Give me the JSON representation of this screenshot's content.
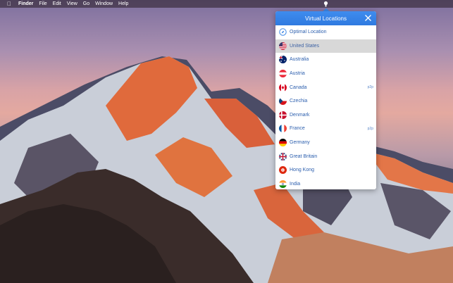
{
  "menubar": {
    "apple_icon": "apple-icon",
    "items": [
      "Finder",
      "File",
      "Edit",
      "View",
      "Go",
      "Window",
      "Help"
    ]
  },
  "panel": {
    "title": "Virtual Locations",
    "accent": "#3a86e6",
    "locations": [
      {
        "label": "Optimal Location",
        "icon": "compass-icon",
        "badge": ""
      },
      {
        "label": "United States",
        "icon": "flag-us-icon",
        "badge": "",
        "selected": true
      },
      {
        "label": "Australia",
        "icon": "flag-au-icon",
        "badge": ""
      },
      {
        "label": "Austria",
        "icon": "flag-at-icon",
        "badge": ""
      },
      {
        "label": "Canada",
        "icon": "flag-ca-icon",
        "badge": "p2p"
      },
      {
        "label": "Czechia",
        "icon": "flag-cz-icon",
        "badge": ""
      },
      {
        "label": "Denmark",
        "icon": "flag-dk-icon",
        "badge": ""
      },
      {
        "label": "France",
        "icon": "flag-fr-icon",
        "badge": "p2p"
      },
      {
        "label": "Germany",
        "icon": "flag-de-icon",
        "badge": ""
      },
      {
        "label": "Great Britain",
        "icon": "flag-gb-icon",
        "badge": ""
      },
      {
        "label": "Hong Kong",
        "icon": "flag-hk-icon",
        "badge": ""
      },
      {
        "label": "India",
        "icon": "flag-in-icon",
        "badge": ""
      }
    ]
  }
}
